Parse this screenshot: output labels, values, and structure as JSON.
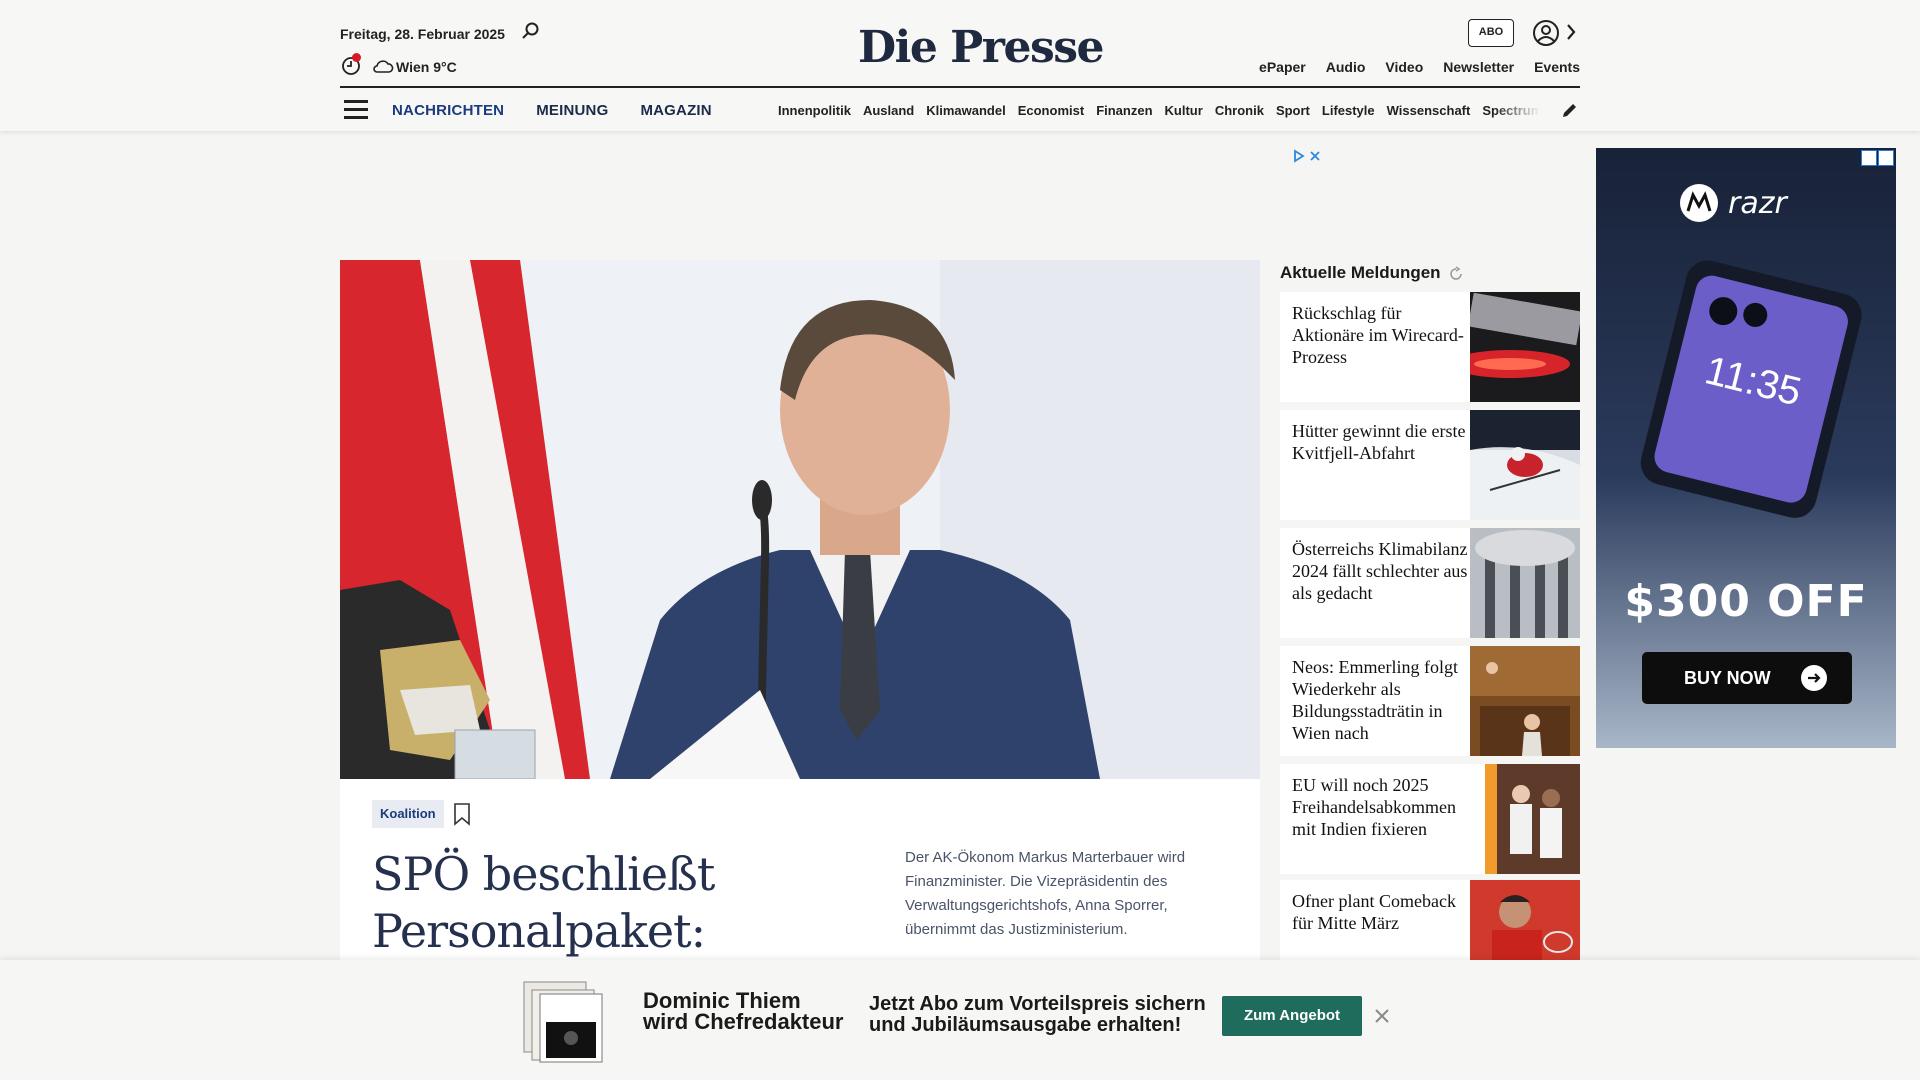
{
  "header": {
    "date": "Freitag, 28. Februar 2025",
    "weather": "Wien 9°C",
    "logo": "Die Presse",
    "abo_label": "ABO",
    "links": [
      "ePaper",
      "Audio",
      "Video",
      "Newsletter",
      "Events"
    ]
  },
  "nav": {
    "main": [
      "NACHRICHTEN",
      "MEINUNG",
      "MAGAZIN"
    ],
    "sub": [
      "Innenpolitik",
      "Ausland",
      "Klimawandel",
      "Economist",
      "Finanzen",
      "Kultur",
      "Chronik",
      "Sport",
      "Lifestyle",
      "Wissenschaft",
      "Spectrum"
    ]
  },
  "lead": {
    "tag": "Koalition",
    "headline": "SPÖ beschließt Personalpaket: „Werden",
    "teaser": "Der AK-Ökonom Markus Marterbauer wird Finanzminister. Die Vizepräsidentin des Verwaltungsgerichtshofs, Anna Sporrer, übernimmt das Justizministerium."
  },
  "sidebar": {
    "title": "Aktuelle Meldungen",
    "items": [
      {
        "title": "Rückschlag für Aktionäre im Wirecard-Prozess"
      },
      {
        "title": "Hütter gewinnt die erste Kvitfjell-Abfahrt"
      },
      {
        "title": "Österreichs Klimabilanz 2024 fällt schlechter aus als gedacht"
      },
      {
        "title": "Neos: Emmerling folgt Wiederkehr als Bildungsstadträtin in Wien nach"
      },
      {
        "title": "EU will noch 2025 Freihandelsabkommen mit Indien fixieren"
      },
      {
        "title": "Ofner plant Comeback für Mitte März"
      }
    ]
  },
  "ad": {
    "brand": "razr",
    "offer": "$300 OFF",
    "button": "BUY NOW",
    "phone_time": "11:35"
  },
  "promo": {
    "name_line1": "Dominic Thiem",
    "name_line2": "wird Chefredakteur",
    "offer_line1": "Jetzt Abo zum Vorteilspreis sichern",
    "offer_line2": "und Jubiläumsausgabe erhalten!",
    "button": "Zum Angebot"
  }
}
